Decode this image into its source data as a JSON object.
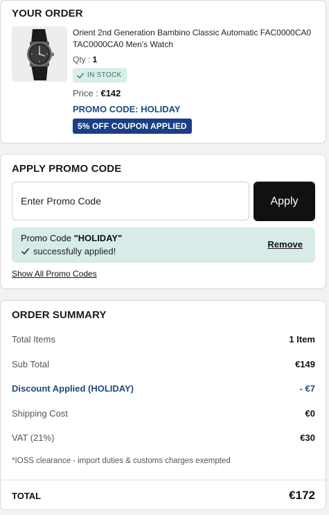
{
  "order": {
    "title": "YOUR ORDER",
    "product_name": "Orient 2nd Generation Bambino Classic Automatic FAC0000CA0 TAC0000CA0 Men's Watch",
    "qty_label": "Qty : ",
    "qty_value": "1",
    "stock_label": "IN STOCK",
    "price_label": "Price : ",
    "price_value": "€142",
    "promo_code_line": "PROMO CODE: HOLIDAY",
    "coupon_badge": "5% OFF COUPON APPLIED",
    "thumbnail_icon": "watch-icon"
  },
  "promo": {
    "title": "APPLY PROMO CODE",
    "input_placeholder": "Enter Promo Code",
    "input_value": "",
    "apply_label": "Apply",
    "success_prefix": "Promo Code ",
    "success_code": "\"HOLIDAY\"",
    "success_message": "successfully applied!",
    "remove_label": "Remove",
    "show_all_label": "Show All Promo Codes"
  },
  "summary": {
    "title": "ORDER SUMMARY",
    "rows": [
      {
        "label": "Total Items",
        "value": "1 Item"
      },
      {
        "label": "Sub Total",
        "value": "€149"
      },
      {
        "label": "Discount Applied (HOLIDAY)",
        "value": "- €7"
      },
      {
        "label": "Shipping Cost",
        "value": "€0"
      },
      {
        "label": "VAT (21%)",
        "value": "€30"
      }
    ],
    "ioss_note": "*IOSS clearance - import duties & customs charges exempted",
    "total_label": "TOTAL",
    "total_value": "€172"
  },
  "colors": {
    "accent_blue": "#1f4a7a",
    "coupon_badge_bg": "#1b3f86",
    "success_bg": "#d7ebe8",
    "apply_button_bg": "#111111"
  }
}
